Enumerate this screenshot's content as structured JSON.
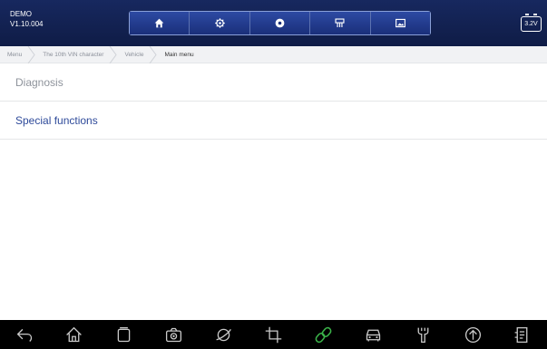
{
  "header": {
    "app_name": "DEMO",
    "version": "V1.10.004",
    "battery_voltage": "3.2V",
    "toolbar": [
      "home-icon",
      "settings-icon",
      "record-icon",
      "obd-icon",
      "image-icon"
    ]
  },
  "breadcrumb": [
    "Menu",
    "The 10th VIN character",
    "Vehicle",
    "Main menu"
  ],
  "menu": [
    {
      "label": "Diagnosis",
      "enabled": false
    },
    {
      "label": "Special functions",
      "enabled": true
    }
  ],
  "navbar": [
    "back-icon",
    "home-icon",
    "recent-apps-icon",
    "camera-icon",
    "browser-icon",
    "crop-icon",
    "link-icon",
    "car-icon",
    "wrench-icon",
    "upload-icon",
    "report-icon"
  ],
  "colors": {
    "header_bg": "#17285f",
    "accent": "#2e4a9a",
    "link_green": "#3bb34a"
  }
}
